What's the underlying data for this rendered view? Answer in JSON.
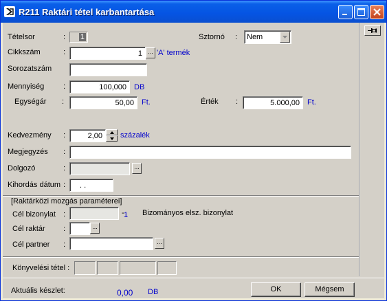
{
  "window": {
    "title": "R211 Raktári tétel karbantartása"
  },
  "colon": ":",
  "form": {
    "tetelsor": {
      "label": "Tételsor",
      "value": "1"
    },
    "sztorno": {
      "label": "Sztornó",
      "value": "Nem"
    },
    "cikkszam": {
      "label": "Cikkszám",
      "value": "1",
      "desc": "'A' termék",
      "btn": "..."
    },
    "sorozatszam": {
      "label": "Sorozatszám",
      "value": ""
    },
    "mennyiseg": {
      "label": "Mennyiség",
      "value": "100,000",
      "unit": "DB"
    },
    "egysegar": {
      "label": "Egységár",
      "value": "50,00",
      "unit": "Ft."
    },
    "ertek": {
      "label": "Érték",
      "value": "5.000,00",
      "unit": "Ft."
    },
    "kedvezmeny": {
      "label": "Kedvezmény",
      "value": "2,00",
      "unit": "százalék"
    },
    "megjegyzes": {
      "label": "Megjegyzés",
      "value": ""
    },
    "dolgozo": {
      "label": "Dolgozó",
      "value": "",
      "btn": "..."
    },
    "kihordas": {
      "label": "Kihordás dátum",
      "value": ". ."
    }
  },
  "raktarkozi": {
    "title": "[Raktárközi mozgás paraméterei]",
    "cel_bizonylat": {
      "label": "Cél bizonylat",
      "value": "",
      "dash": "-",
      "number": "1",
      "note": "Bizományos elsz. bizonylat"
    },
    "cel_raktar": {
      "label": "Cél raktár",
      "value": "",
      "btn": "..."
    },
    "cel_partner": {
      "label": "Cél partner",
      "value": "",
      "btn": "..."
    }
  },
  "konyvelesi": {
    "label": "Könyvelési tétel :"
  },
  "footer": {
    "keszlet_label": "Aktuális készlet:",
    "keszlet_value": "0,00",
    "keszlet_unit": "DB",
    "ok": "OK",
    "cancel": "Mégsem"
  },
  "colors": {
    "title_bar": "#0554e3",
    "accent_text": "#0000cc",
    "face": "#d4d0c8"
  }
}
